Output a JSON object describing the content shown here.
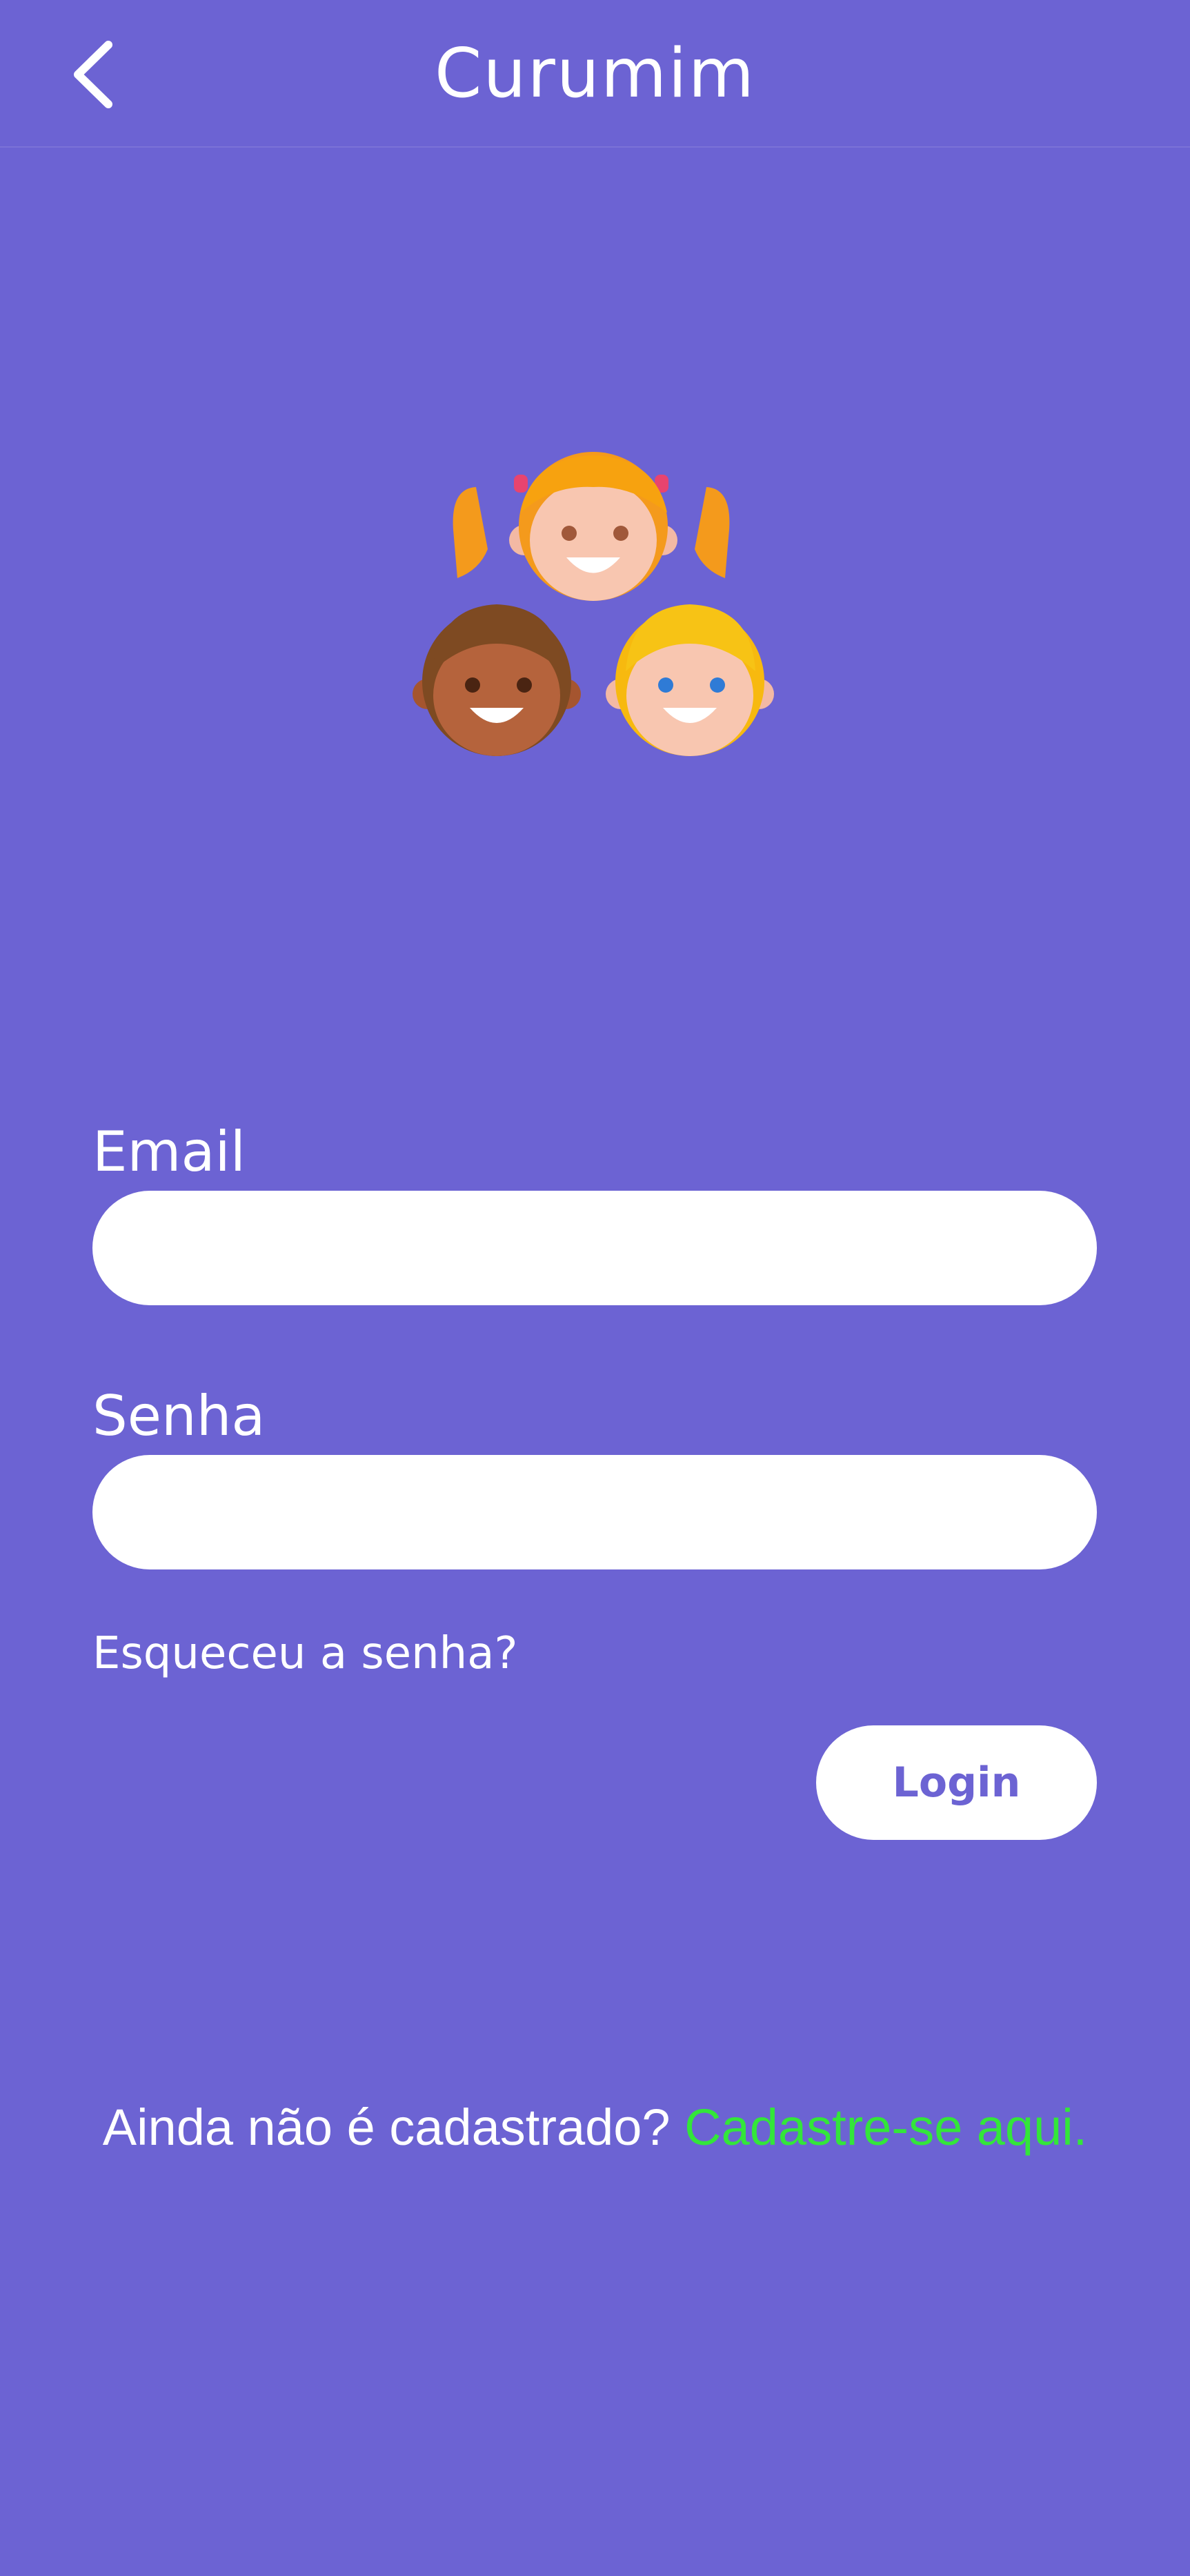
{
  "app_bar": {
    "title": "Curumim",
    "back_icon": "chevron-left-icon"
  },
  "logo": {
    "icon": "three-children-faces-icon"
  },
  "form": {
    "email_label": "Email",
    "email_value": "",
    "password_label": "Senha",
    "password_value": "",
    "forgot_password": "Esqueceu a senha?",
    "login_button": "Login"
  },
  "signup": {
    "prompt": "Ainda não é cadastrado?",
    "link": "Cadastre-se aqui."
  },
  "colors": {
    "background": "#6c63d3",
    "accent_link": "#33e63a",
    "surface": "#ffffff"
  }
}
